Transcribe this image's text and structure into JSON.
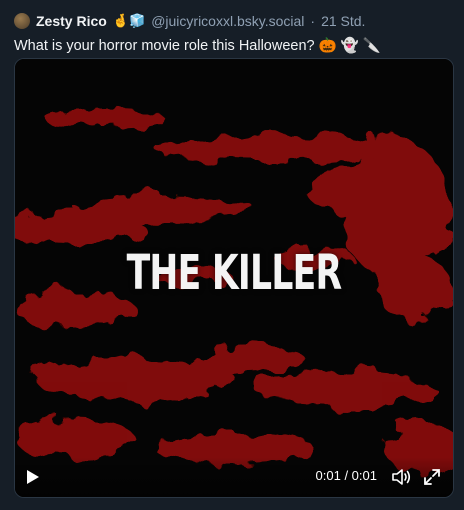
{
  "post": {
    "author_name": "Zesty Rico",
    "author_emoji": "🤞🧊",
    "handle": "@juicyricoxxl.bsky.social",
    "separator": "·",
    "time_ago": "21 Std.",
    "text": "What is your horror movie role this Halloween? 🎃 👻 🔪"
  },
  "video": {
    "overlay_title": "THE KILLER",
    "time_display": "0:01 / 0:01",
    "play_icon": "play-icon",
    "volume_icon": "volume-icon",
    "fullscreen_icon": "fullscreen-icon"
  },
  "colors": {
    "background": "#161e27",
    "blood_red": "#8b0c0a",
    "text_muted": "#8fa0b3"
  }
}
